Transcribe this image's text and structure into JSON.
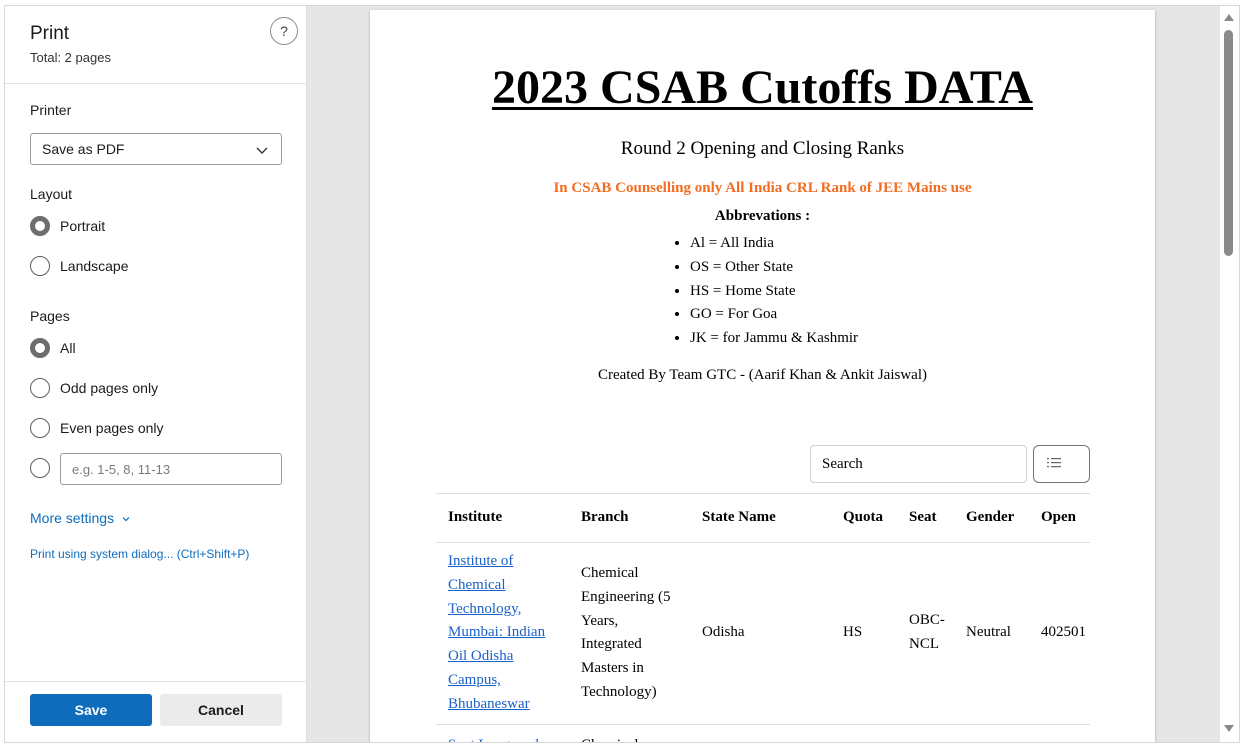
{
  "settings": {
    "title": "Print",
    "page_count": "Total: 2 pages",
    "help_icon": "question-mark-icon",
    "printer_label": "Printer",
    "printer_value": "Save as PDF",
    "layout_label": "Layout",
    "layout_options": [
      "Portrait",
      "Landscape"
    ],
    "layout_selected": "Portrait",
    "pages_label": "Pages",
    "pages_options": [
      "All",
      "Odd pages only",
      "Even pages only"
    ],
    "pages_selected": "All",
    "custom_range_placeholder": "e.g. 1-5, 8, 11-13",
    "more_settings": "More settings",
    "system_dialog": "Print using system dialog... (Ctrl+Shift+P)",
    "save_label": "Save",
    "cancel_label": "Cancel"
  },
  "colors": {
    "accent": "#0f6cbd",
    "note_orange": "#f26d21",
    "link_blue": "#1a61c9"
  },
  "document": {
    "title": "2023 CSAB Cutoffs DATA",
    "subtitle": "Round 2 Opening and Closing Ranks",
    "note": "In CSAB Counselling only All India CRL Rank of JEE Mains use",
    "abbr_heading": "Abbrevations :",
    "abbreviations": [
      "Al = All India",
      "OS = Other State",
      "HS = Home State",
      "GO = For Goa",
      "JK = for Jammu & Kashmir"
    ],
    "credit": "Created By Team GTC - (Aarif Khan & Ankit Jaiswal)",
    "search_text": "Search",
    "list_icon": "list-icon",
    "table": {
      "headers": [
        "Institute",
        "Branch",
        "State Name",
        "Quota",
        "Seat",
        "Gender",
        "Open"
      ],
      "rows": [
        {
          "institute": [
            "Institute of",
            "Chemical",
            "Technology,",
            "Mumbai: Indian",
            "Oil Odisha",
            "Campus,",
            "Bhubaneswar"
          ],
          "branch": [
            "Chemical",
            "Engineering (5",
            "Years,",
            "Integrated",
            "Masters in",
            "Technology)"
          ],
          "state": "Odisha",
          "quota": "HS",
          "seat": [
            "OBC-",
            "NCL"
          ],
          "gender": "Neutral",
          "open": "402501"
        }
      ],
      "next_row_partial": {
        "institute": "Sant Longowal",
        "branch": "Chemical"
      }
    }
  }
}
